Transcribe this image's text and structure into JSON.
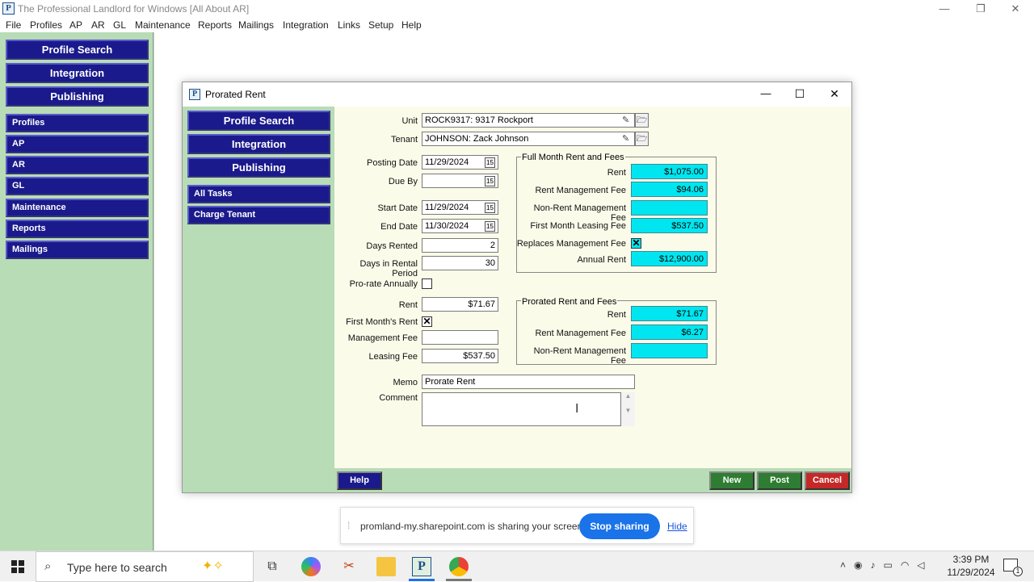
{
  "app": {
    "title": "The Professional Landlord for Windows [All About AR]",
    "logo": "P",
    "controls": {
      "minimize": "—",
      "restore": "❐",
      "close": "✕"
    }
  },
  "menu": [
    "File",
    "Profiles",
    "AP",
    "AR",
    "GL",
    "Maintenance",
    "Reports",
    "Mailings",
    "Integration",
    "Links",
    "Setup",
    "Help"
  ],
  "sidebar": {
    "buttons": [
      "Profile Search",
      "Integration",
      "Publishing"
    ],
    "items": [
      "Profiles",
      "AP",
      "AR",
      "GL",
      "Maintenance",
      "Reports",
      "Mailings"
    ]
  },
  "dialog": {
    "title": "Prorated Rent",
    "left_buttons": [
      "Profile Search",
      "Integration",
      "Publishing"
    ],
    "left_items": [
      "All Tasks",
      "Charge Tenant"
    ],
    "form": {
      "unit_label": "Unit",
      "unit_value": "ROCK9317: 9317 Rockport",
      "tenant_label": "Tenant",
      "tenant_value": "JOHNSON: Zack Johnson",
      "posting_date_label": "Posting Date",
      "posting_date": "11/29/2024",
      "due_by_label": "Due By",
      "due_by": "",
      "start_date_label": "Start Date",
      "start_date": "11/29/2024",
      "end_date_label": "End Date",
      "end_date": "11/30/2024",
      "days_rented_label": "Days Rented",
      "days_rented": "2",
      "days_period_label": "Days in Rental Period",
      "days_period": "30",
      "prorate_annually_label": "Pro-rate Annually",
      "prorate_annually": "",
      "rent_label": "Rent",
      "rent": "$71.67",
      "first_month_label": "First Month's Rent",
      "first_month": "✕",
      "mgmt_fee_label": "Management Fee",
      "mgmt_fee": "",
      "leasing_fee_label": "Leasing Fee",
      "leasing_fee": "$537.50",
      "memo_label": "Memo",
      "memo": "Prorate Rent",
      "comment_label": "Comment",
      "comment": ""
    },
    "full_month": {
      "title": "Full Month Rent and Fees",
      "rent_label": "Rent",
      "rent": "$1,075.00",
      "rmf_label": "Rent Management Fee",
      "rmf": "$94.06",
      "nrmf_label": "Non-Rent Management Fee",
      "nrmf": "",
      "fmlf_label": "First Month Leasing Fee",
      "fmlf": "$537.50",
      "replaces_label": "Replaces Management Fee",
      "replaces": "✕",
      "annual_label": "Annual Rent",
      "annual": "$12,900.00"
    },
    "prorated": {
      "title": "Prorated Rent and Fees",
      "rent_label": "Rent",
      "rent": "$71.67",
      "rmf_label": "Rent Management Fee",
      "rmf": "$6.27",
      "nrmf_label": "Non-Rent Management Fee",
      "nrmf": ""
    },
    "footer": {
      "help": "Help",
      "new": "New",
      "post": "Post",
      "cancel": "Cancel"
    },
    "colors": {
      "new": "#2e7d32",
      "post": "#2e7d32",
      "cancel": "#c62828",
      "help": "#1a1a8c"
    }
  },
  "share_bar": {
    "text": "promland-my.sharepoint.com is sharing your screen.",
    "stop": "Stop sharing",
    "hide": "Hide"
  },
  "taskbar": {
    "search_placeholder": "Type here to search",
    "time": "3:39 PM",
    "date": "11/29/2024",
    "notification_count": "1"
  }
}
